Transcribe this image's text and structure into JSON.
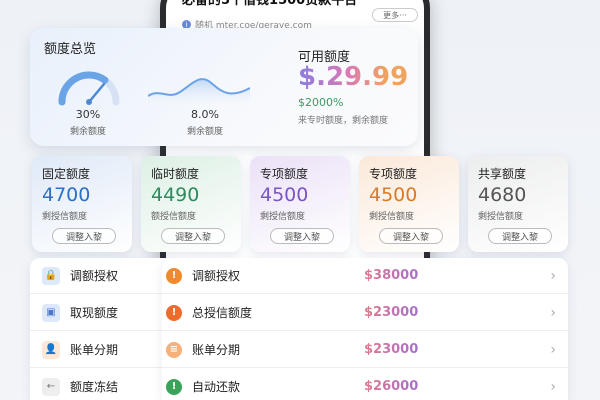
{
  "phone": {
    "title": "必备的5个借钱1500贷款平台",
    "url": "随机 mter.coe/geraye.com",
    "more": "更多···"
  },
  "overview": {
    "title": "额度总览",
    "gauge": {
      "percent": "30%",
      "label": "剩余额度",
      "fill": 0.3
    },
    "wave": {
      "percent": "8.0%",
      "label": "剩余额度"
    },
    "available": {
      "title": "可用额度",
      "amount": "$.29.99",
      "percent": "$2000%",
      "note": "来专时额度，剩余额度"
    }
  },
  "quotas": [
    {
      "title": "固定额度",
      "value": "4700",
      "sub": "剩授信额度",
      "button": "调整入黎",
      "color": "#2d6fc2",
      "bg": "#dfe9f7"
    },
    {
      "title": "临时额度",
      "value": "4490",
      "sub": "额授信额度",
      "button": "调整入黎",
      "color": "#2f8a5d",
      "bg": "#ddf0e5"
    },
    {
      "title": "专项额度",
      "value": "4500",
      "sub": "剩授信额度",
      "button": "调整入黎",
      "color": "#7a55c4",
      "bg": "#ebe1f7"
    },
    {
      "title": "专项额度",
      "value": "4500",
      "sub": "剩授信额度",
      "button": "调整入黎",
      "color": "#d87a2a",
      "bg": "#fbe9da"
    },
    {
      "title": "共享额度",
      "value": "4680",
      "sub": "剩授信额度",
      "button": "调整入黎",
      "color": "#555555",
      "bg": "#eceded"
    }
  ],
  "left_list": [
    {
      "label": "调额授权",
      "icon": "lock-icon",
      "glyph": "🔒",
      "bg": "#dde8f8",
      "color": "#4a78c8"
    },
    {
      "label": "取现额度",
      "icon": "square-icon",
      "glyph": "▣",
      "bg": "#dde8f8",
      "color": "#4a78c8"
    },
    {
      "label": "账单分期",
      "icon": "person-icon",
      "glyph": "👤",
      "bg": "#fde7d6",
      "color": "#e5833a"
    },
    {
      "label": "额度冻结",
      "icon": "arrow-left-icon",
      "glyph": "←",
      "bg": "#eeeeee",
      "color": "#777777"
    }
  ],
  "right_list": [
    {
      "label": "调额授权",
      "amount": "$38000",
      "icon": "alert-icon",
      "glyph": "!",
      "bg": "#f08a2c"
    },
    {
      "label": "总授信额度",
      "amount": "$23000",
      "icon": "alert-icon",
      "glyph": "!",
      "bg": "#ef6b2a"
    },
    {
      "label": "账单分期",
      "amount": "$23000",
      "icon": "document-icon",
      "glyph": "≡",
      "bg": "#f6b07a"
    },
    {
      "label": "自动还款",
      "amount": "$26000",
      "icon": "alert-icon",
      "glyph": "!",
      "bg": "#3aa35a"
    }
  ]
}
